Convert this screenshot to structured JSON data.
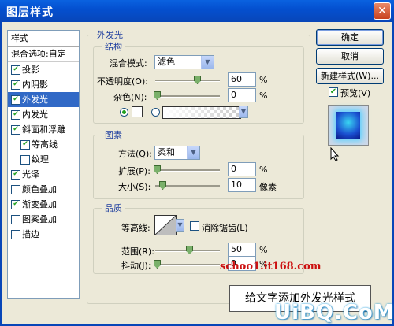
{
  "window": {
    "title": "图层样式"
  },
  "styles_panel": {
    "header": "样式",
    "blend_options": "混合选项:自定",
    "items": [
      {
        "label": "投影",
        "checked": true
      },
      {
        "label": "内阴影",
        "checked": true
      },
      {
        "label": "外发光",
        "checked": true,
        "selected": true
      },
      {
        "label": "内发光",
        "checked": true
      },
      {
        "label": "斜面和浮雕",
        "checked": true
      },
      {
        "label": "等高线",
        "checked": true,
        "indent": true
      },
      {
        "label": "纹理",
        "checked": false,
        "indent": true
      },
      {
        "label": "光泽",
        "checked": true
      },
      {
        "label": "颜色叠加",
        "checked": false
      },
      {
        "label": "渐变叠加",
        "checked": true
      },
      {
        "label": "图案叠加",
        "checked": false
      },
      {
        "label": "描边",
        "checked": false
      }
    ]
  },
  "outer_glow": {
    "title": "外发光",
    "structure": {
      "title": "结构",
      "blend_mode_label": "混合模式:",
      "blend_mode": "滤色",
      "opacity_label": "不透明度(O):",
      "opacity": "60",
      "noise_label": "杂色(N):",
      "noise": "0",
      "unit": "%"
    },
    "elements": {
      "title": "图素",
      "method_label": "方法(Q):",
      "method": "柔和",
      "spread_label": "扩展(P):",
      "spread": "0",
      "size_label": "大小(S):",
      "size": "10",
      "unit_percent": "%",
      "unit_pixel": "像素"
    },
    "quality": {
      "title": "品质",
      "contour_label": "等高线:",
      "antialias_label": "消除锯齿(L)",
      "range_label": "范围(R):",
      "range": "50",
      "jitter_label": "抖动(J):",
      "jitter": "0",
      "unit": "%"
    }
  },
  "buttons": {
    "ok": "确定",
    "cancel": "取消",
    "new_style": "新建样式(W)...",
    "preview": "预览(V)"
  },
  "overlay": {
    "watermark": "schoo1.it168.com",
    "caption": "给文字添加外发光样式",
    "logo": "UiBQ.CoM"
  }
}
